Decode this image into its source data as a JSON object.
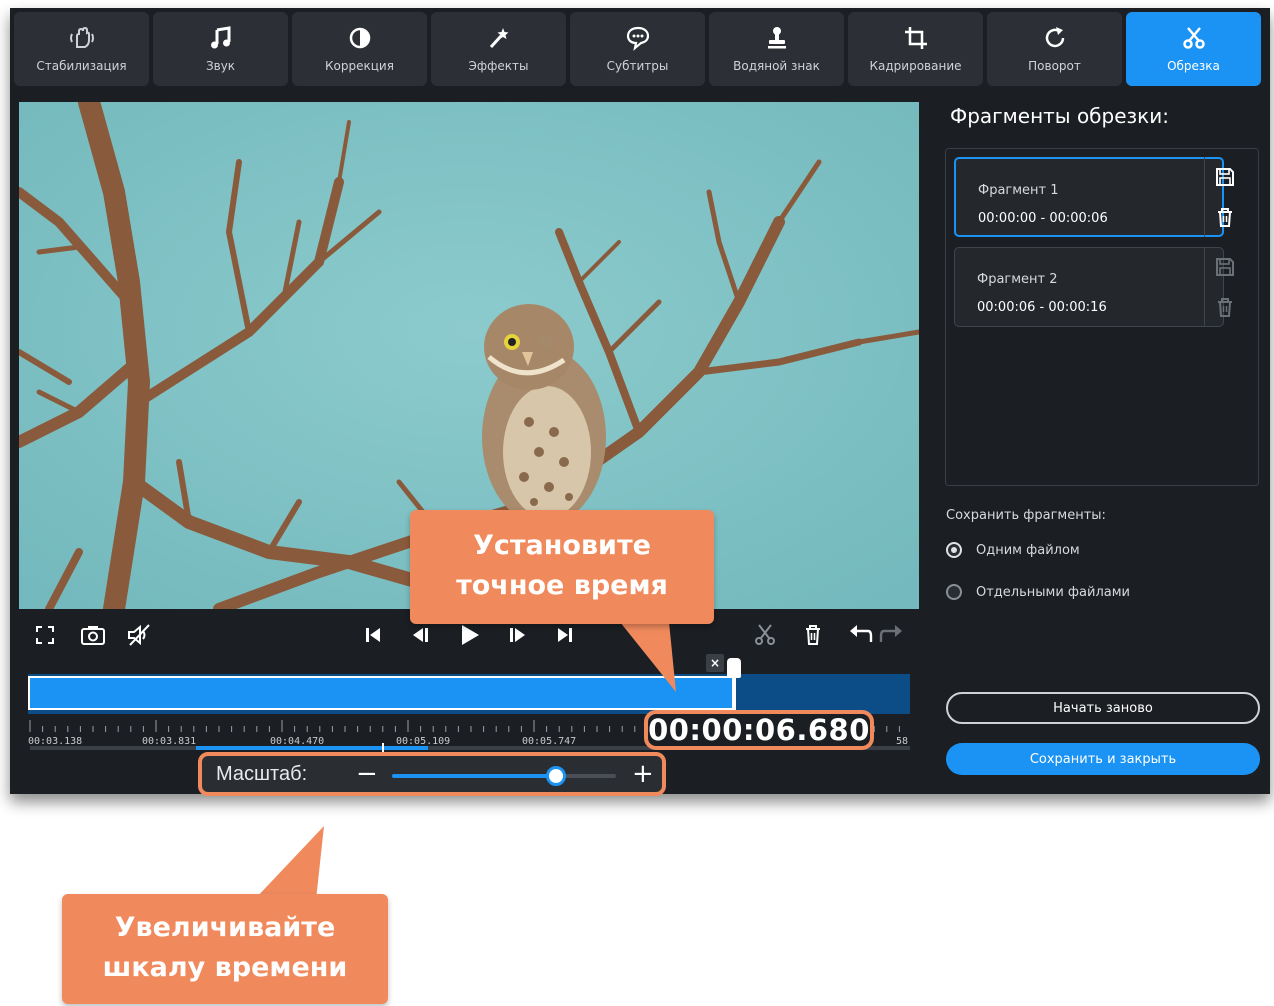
{
  "toolbar": {
    "tabs": [
      {
        "label": "Стабилизация",
        "icon": "stabilization-hand-icon"
      },
      {
        "label": "Звук",
        "icon": "music-note-icon"
      },
      {
        "label": "Коррекция",
        "icon": "contrast-icon"
      },
      {
        "label": "Эффекты",
        "icon": "magic-wand-icon"
      },
      {
        "label": "Субтитры",
        "icon": "speech-bubble-icon"
      },
      {
        "label": "Водяной знак",
        "icon": "stamp-icon"
      },
      {
        "label": "Кадрирование",
        "icon": "crop-icon"
      },
      {
        "label": "Поворот",
        "icon": "rotate-icon"
      },
      {
        "label": "Обрезка",
        "icon": "scissors-icon",
        "active": true
      }
    ]
  },
  "timeline": {
    "ticks": [
      "00:03.138",
      "00:03.831",
      "00:04.470",
      "00:05.109",
      "00:05.747"
    ],
    "tick_end_fragment": "58",
    "current_time": "00:00:06.680"
  },
  "zoom": {
    "label": "Масштаб:",
    "minus": "−",
    "plus": "+",
    "level": 0.73
  },
  "panel": {
    "title": "Фрагменты обрезки:",
    "fragments": [
      {
        "name": "Фрагмент 1",
        "range": "00:00:00 - 00:00:06"
      },
      {
        "name": "Фрагмент 2",
        "range": "00:00:06 - 00:00:16"
      }
    ],
    "save_label": "Сохранить фрагменты:",
    "options": [
      "Одним файлом",
      "Отдельными файлами"
    ],
    "restart_label": "Начать заново",
    "save_close_label": "Сохранить и закрыть"
  },
  "callouts": {
    "time_line1": "Установите",
    "time_line2": "точное время",
    "zoom_line1": "Увеличивайте",
    "zoom_line2": "шкалу времени"
  },
  "colors": {
    "accent": "#1a93f4",
    "callout": "#f08a5d",
    "background": "#1b1e22"
  }
}
